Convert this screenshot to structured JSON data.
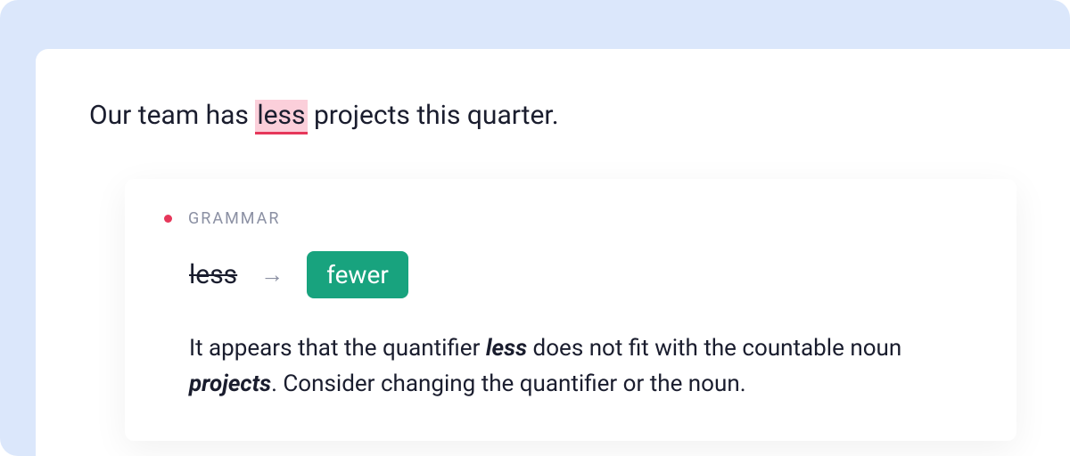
{
  "sentence": {
    "pre": "Our team has ",
    "flagged": "less",
    "post": " projects this quarter."
  },
  "suggestion": {
    "category": "GRAMMAR",
    "original": "less",
    "replacement": "fewer",
    "explanation": {
      "p1": "It appears that the quantifier ",
      "w1": "less",
      "p2": " does not fit with the countable noun ",
      "w2": "projects",
      "p3": ". Consider changing the quantifier or the noun."
    }
  }
}
